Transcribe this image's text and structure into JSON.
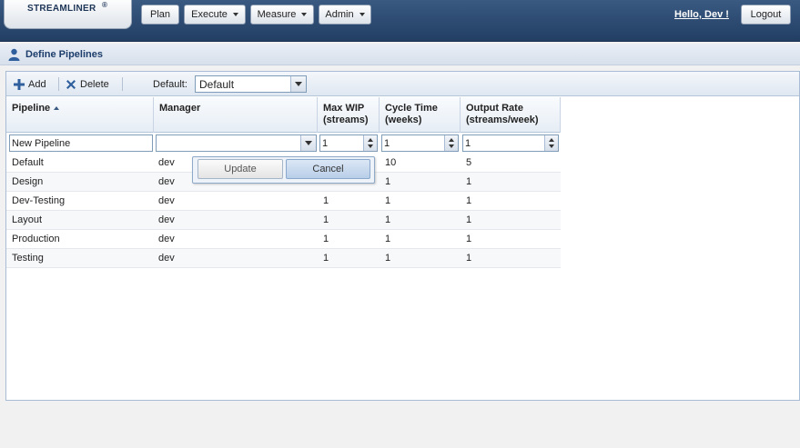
{
  "header": {
    "logo_text": "STREAMLINER",
    "logo_mark": "®",
    "nav": [
      {
        "label": "Plan",
        "dropdown": false
      },
      {
        "label": "Execute",
        "dropdown": true
      },
      {
        "label": "Measure",
        "dropdown": true
      },
      {
        "label": "Admin",
        "dropdown": true
      }
    ],
    "greeting": "Hello, Dev !",
    "logout_label": "Logout"
  },
  "section": {
    "title": "Define Pipelines",
    "icon": "user-icon"
  },
  "toolbar": {
    "add_label": "Add",
    "delete_label": "Delete",
    "default_label": "Default:",
    "default_value": "Default"
  },
  "table": {
    "columns": [
      {
        "line1": "Pipeline",
        "line2": "",
        "sorted": "asc"
      },
      {
        "line1": "Manager",
        "line2": ""
      },
      {
        "line1": "Max WIP",
        "line2": "(streams)"
      },
      {
        "line1": "Cycle Time",
        "line2": "(weeks)"
      },
      {
        "line1": "Output Rate",
        "line2": "(streams/week)"
      }
    ],
    "edit_row": {
      "pipeline": "New Pipeline",
      "manager": "",
      "max_wip": "1",
      "cycle_time": "1",
      "output_rate": "1"
    },
    "rows": [
      {
        "pipeline": "Default",
        "manager": "dev",
        "max_wip": "",
        "cycle_time": "10",
        "output_rate": "5"
      },
      {
        "pipeline": "Design",
        "manager": "dev",
        "max_wip": "",
        "cycle_time": "1",
        "output_rate": "1"
      },
      {
        "pipeline": "Dev-Testing",
        "manager": "dev",
        "max_wip": "1",
        "cycle_time": "1",
        "output_rate": "1"
      },
      {
        "pipeline": "Layout",
        "manager": "dev",
        "max_wip": "1",
        "cycle_time": "1",
        "output_rate": "1"
      },
      {
        "pipeline": "Production",
        "manager": "dev",
        "max_wip": "1",
        "cycle_time": "1",
        "output_rate": "1"
      },
      {
        "pipeline": "Testing",
        "manager": "dev",
        "max_wip": "1",
        "cycle_time": "1",
        "output_rate": "1"
      }
    ]
  },
  "popup": {
    "update_label": "Update",
    "cancel_label": "Cancel"
  }
}
